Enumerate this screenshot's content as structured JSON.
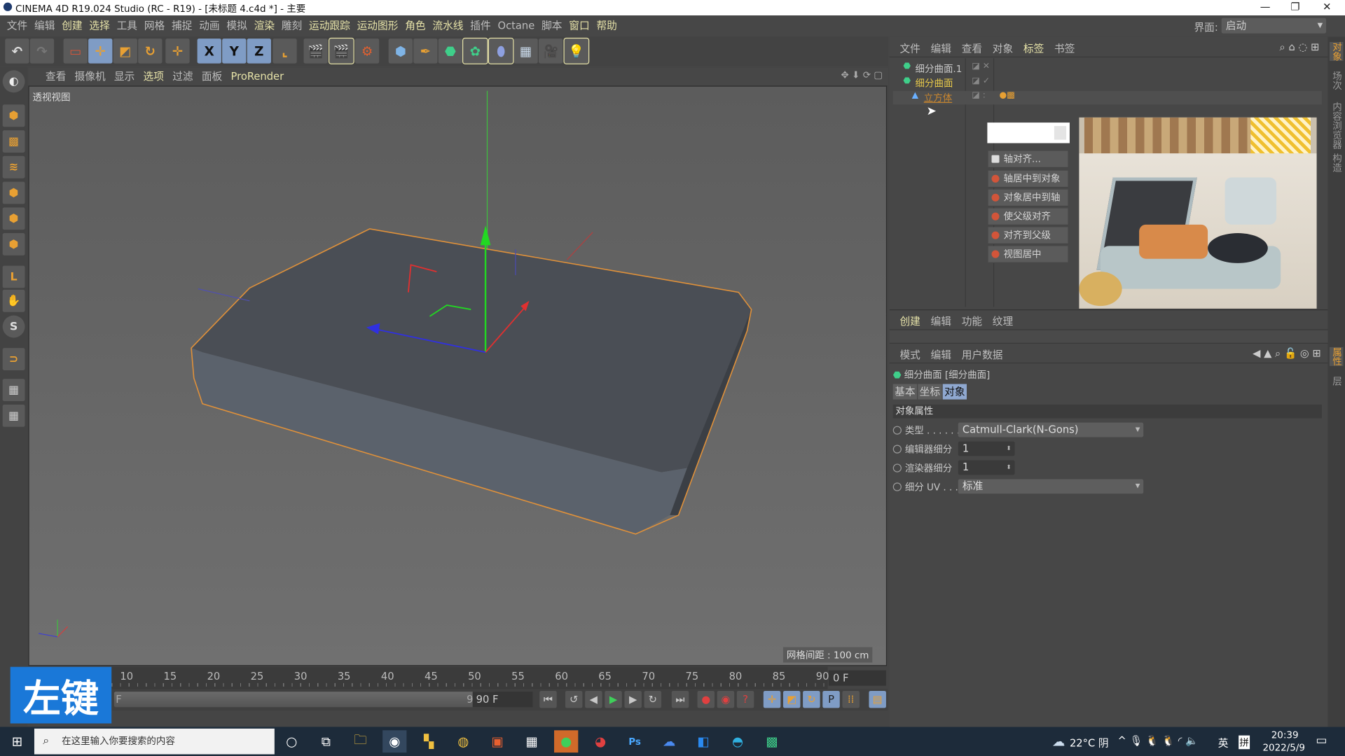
{
  "window": {
    "title": "CINEMA 4D R19.024 Studio (RC - R19) - [未标题 4.c4d *] - 主要",
    "minimize": "—",
    "maximize": "❐",
    "close": "✕"
  },
  "menu": [
    {
      "label": "文件",
      "hl": false
    },
    {
      "label": "编辑",
      "hl": false
    },
    {
      "label": "创建",
      "hl": true
    },
    {
      "label": "选择",
      "hl": true
    },
    {
      "label": "工具",
      "hl": false
    },
    {
      "label": "网格",
      "hl": false
    },
    {
      "label": "捕捉",
      "hl": false
    },
    {
      "label": "动画",
      "hl": false
    },
    {
      "label": "模拟",
      "hl": false
    },
    {
      "label": "渲染",
      "hl": true
    },
    {
      "label": "雕刻",
      "hl": false
    },
    {
      "label": "运动跟踪",
      "hl": true
    },
    {
      "label": "运动图形",
      "hl": true
    },
    {
      "label": "角色",
      "hl": true
    },
    {
      "label": "流水线",
      "hl": true
    },
    {
      "label": "插件",
      "hl": false
    },
    {
      "label": "Octane",
      "hl": false
    },
    {
      "label": "脚本",
      "hl": false
    },
    {
      "label": "窗口",
      "hl": true
    },
    {
      "label": "帮助",
      "hl": true
    }
  ],
  "interface": {
    "label": "界面:",
    "value": "启动"
  },
  "toolbar": {
    "x": "X",
    "y": "Y",
    "z": "Z"
  },
  "viewport": {
    "menu": [
      "查看",
      "摄像机",
      "显示",
      "选项",
      "过滤",
      "面板",
      "ProRender"
    ],
    "name": "透视视图",
    "grid": "网格间距 : 100 cm"
  },
  "timeline": {
    "ticks": [
      "10",
      "15",
      "20",
      "25",
      "30",
      "35",
      "40",
      "45",
      "50",
      "55",
      "60",
      "65",
      "70",
      "75",
      "80",
      "85",
      "90"
    ],
    "current_frame": "0 F",
    "range_start": "F",
    "range_end": "90 F",
    "end_frame": "90 F"
  },
  "overlay": {
    "caption": "左键"
  },
  "object_manager": {
    "menu": [
      "文件",
      "编辑",
      "查看",
      "对象",
      "标签",
      "书签"
    ],
    "objects": [
      {
        "name": "细分曲面.1",
        "color": "#c8c8c8"
      },
      {
        "name": "细分曲面",
        "color": "#e6c84a"
      },
      {
        "name": "立方体",
        "color": "#c8862e"
      }
    ]
  },
  "context_menu": [
    "轴对齐...",
    "轴居中到对象",
    "对象居中到轴",
    "使父级对齐",
    "对齐到父级",
    "视图居中"
  ],
  "right_tabs": [
    "对象",
    "场次",
    "内容浏览器",
    "构造"
  ],
  "attr_right_tabs": [
    "属性",
    "层"
  ],
  "create_bar": [
    "创建",
    "编辑",
    "功能",
    "纹理"
  ],
  "attributes": {
    "menu": [
      "模式",
      "编辑",
      "用户数据"
    ],
    "title": "细分曲面 [细分曲面]",
    "tabs": [
      "基本",
      "坐标",
      "对象"
    ],
    "active_tab": "对象",
    "section": "对象属性",
    "fields": [
      {
        "label": "类型 . . . . . .",
        "value": "Catmull-Clark(N-Gons)"
      },
      {
        "label": "编辑器细分",
        "value": "1"
      },
      {
        "label": "渲染器细分",
        "value": "1"
      },
      {
        "label": "细分 UV . . .",
        "value": "标准"
      }
    ]
  },
  "taskbar": {
    "search_placeholder": "在这里输入你要搜索的内容",
    "weather": "22°C 阴",
    "ime_lang": "英",
    "ime": "拼",
    "time": "20:39",
    "date": "2022/5/9"
  }
}
